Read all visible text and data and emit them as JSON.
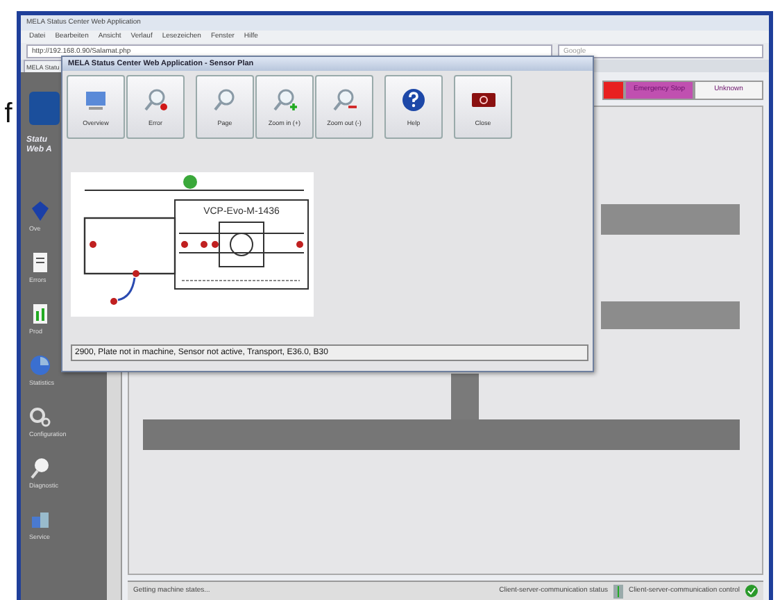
{
  "margin_text": "f",
  "browser": {
    "title": "MELA Status Center Web Application",
    "menu": [
      "Datei",
      "Bearbeiten",
      "Ansicht",
      "Verlauf",
      "Lesezeichen",
      "Fenster",
      "Hilfe"
    ],
    "address": "http://192.168.0.90/Salamat.php",
    "search_placeholder": "Google",
    "tab": "MELA Statu"
  },
  "sidebar": {
    "title_lines": [
      "Statu",
      "Web A"
    ],
    "items": [
      {
        "label": "Ove",
        "kind": "gem"
      },
      {
        "label": "Errors",
        "kind": "list"
      },
      {
        "label": "Prod",
        "kind": "chart"
      },
      {
        "label": "Statistics",
        "kind": "pie"
      },
      {
        "label": "Configuration",
        "kind": "gears"
      },
      {
        "label": "Diagnostic",
        "kind": "magnifier"
      },
      {
        "label": "Service",
        "kind": "service"
      }
    ]
  },
  "status_chips": [
    {
      "color": "#e82020"
    },
    {
      "label": "Emergency Stop",
      "color": "#c050b0"
    },
    {
      "label": "Unknown",
      "color": "#f4f4f4"
    }
  ],
  "status_bar": {
    "message": "Getting machine states...",
    "comm_status": "Client-server-communication status",
    "comm_control": "Client-server-communication control"
  },
  "dialog": {
    "title": "MELA Status Center Web Application - Sensor Plan",
    "tool_groups": [
      [
        {
          "label": "Overview",
          "kind": "overview"
        },
        {
          "label": "Error",
          "kind": "error"
        }
      ],
      [
        {
          "label": "Page",
          "kind": "page"
        },
        {
          "label": "Zoom in (+)",
          "kind": "zoomin"
        },
        {
          "label": "Zoom out (-)",
          "kind": "zoomout"
        }
      ],
      [
        {
          "label": "Help",
          "kind": "help"
        }
      ],
      [
        {
          "label": "Close",
          "kind": "close"
        }
      ]
    ],
    "diagram": {
      "machine": "VCP-Evo-M-1436"
    },
    "message": "2900, Plate not in machine, Sensor not active, Transport, E36.0, B30"
  }
}
